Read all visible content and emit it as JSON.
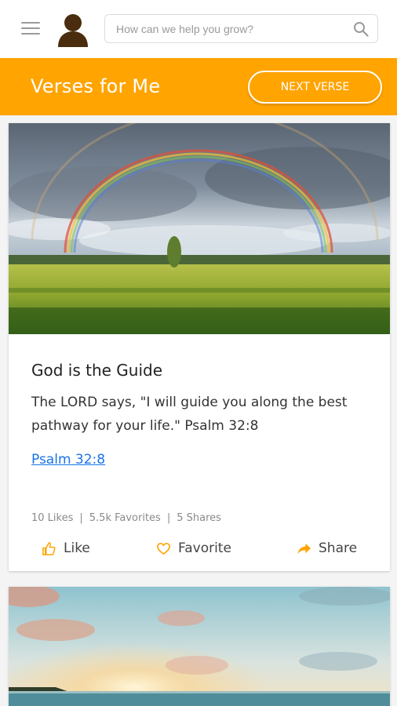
{
  "search": {
    "placeholder": "How can we help you grow?"
  },
  "header": {
    "title": "Verses for Me",
    "next_button": "NEXT VERSE"
  },
  "verse_card": {
    "title": "God is the Guide",
    "text": "The LORD says, \"I will guide you along the best pathway for your life.\" Psalm 32:8",
    "link": "Psalm 32:8",
    "stats": {
      "likes": "10 Likes",
      "favorites": "5.5k Favorites",
      "shares": "5 Shares",
      "separator": "|"
    },
    "actions": {
      "like": "Like",
      "favorite": "Favorite",
      "share": "Share"
    }
  },
  "icons": [
    "menu-icon",
    "avatar-icon",
    "search-icon",
    "thumbs-up-icon",
    "heart-icon",
    "share-arrow-icon"
  ],
  "colors": {
    "accent": "#ffa400",
    "link": "#1a73e8",
    "stats": "#8a8a8a"
  }
}
